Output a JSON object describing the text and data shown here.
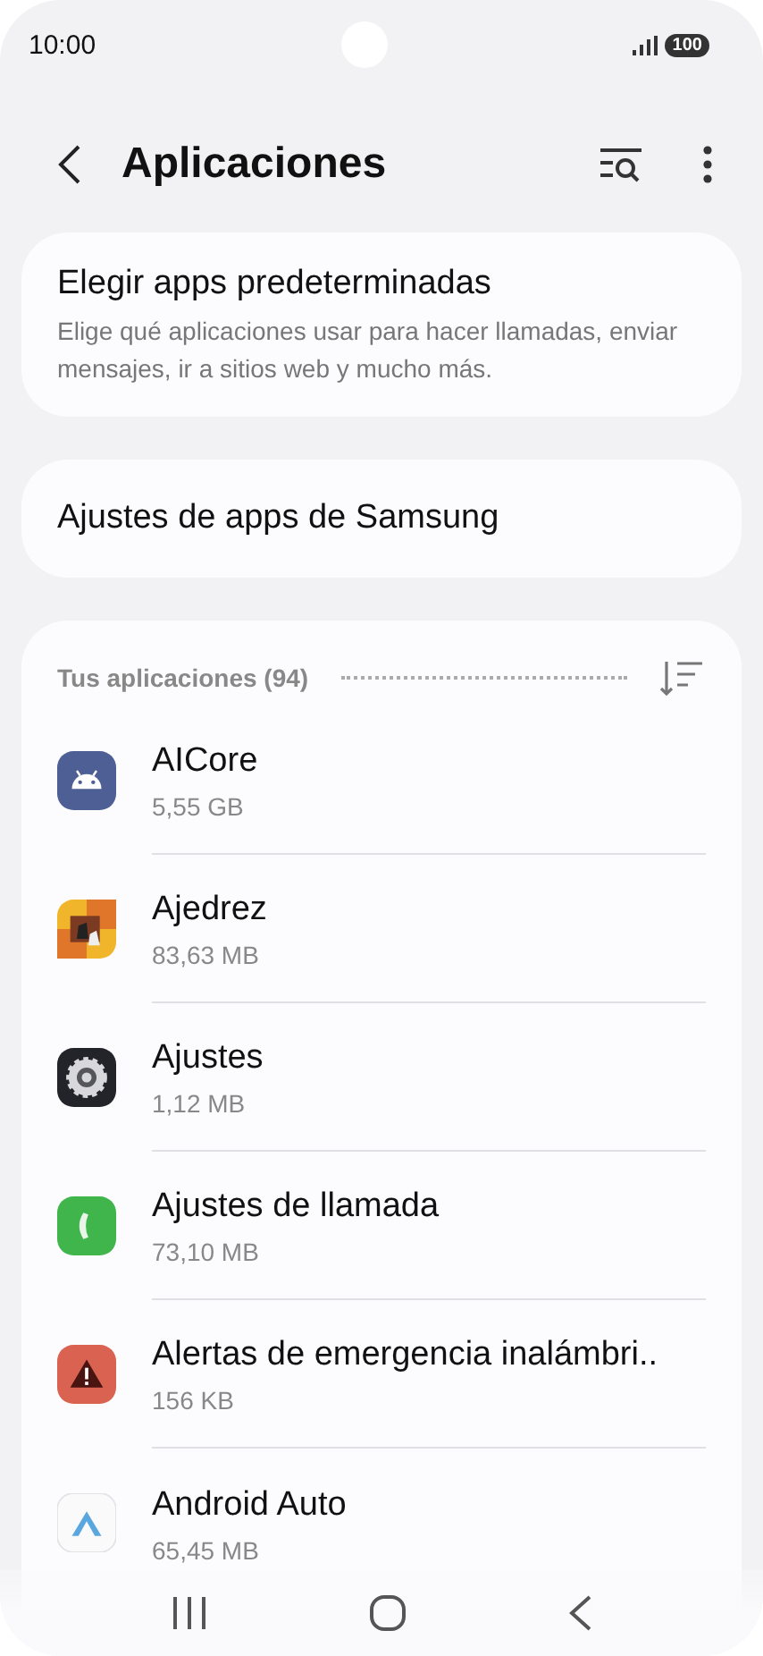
{
  "status_bar": {
    "time": "10:00",
    "battery": "100"
  },
  "header": {
    "title": "Aplicaciones"
  },
  "default_apps": {
    "title": "Elegir apps predeterminadas",
    "subtitle": "Elige qué aplicaciones usar para hacer llamadas, enviar mensajes, ir a sitios web y mucho más."
  },
  "samsung_settings": {
    "title": "Ajustes de apps de Samsung"
  },
  "apps_section": {
    "title": "Tus aplicaciones (94)"
  },
  "apps": [
    {
      "name": "AICore",
      "size": "5,55 GB"
    },
    {
      "name": "Ajedrez",
      "size": "83,63 MB"
    },
    {
      "name": "Ajustes",
      "size": "1,12 MB"
    },
    {
      "name": "Ajustes de llamada",
      "size": "73,10 MB"
    },
    {
      "name": "Alertas de emergencia inalámbri..",
      "size": "156 KB"
    },
    {
      "name": "Android Auto",
      "size": "65,45 MB"
    }
  ]
}
